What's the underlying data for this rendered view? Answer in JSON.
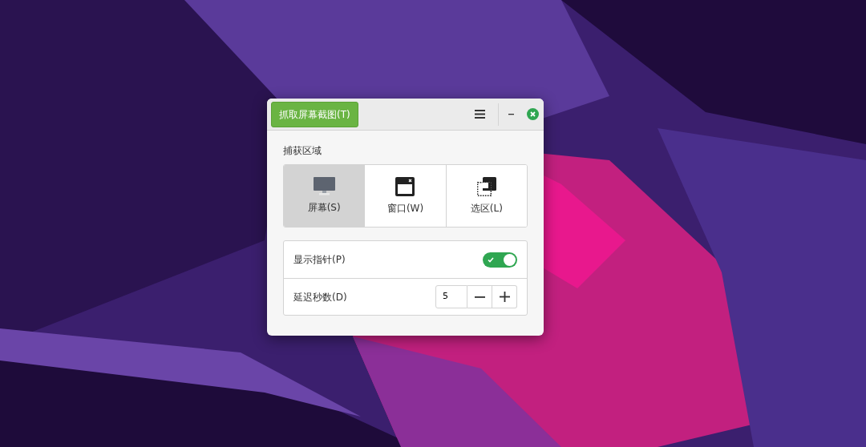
{
  "window": {
    "capture_button": "抓取屏幕截图(T)"
  },
  "area": {
    "label": "捕获区域",
    "modes": [
      {
        "kind": "screen",
        "label": "屏幕(S)",
        "selected": true
      },
      {
        "kind": "window",
        "label": "窗口(W)",
        "selected": false
      },
      {
        "kind": "selection",
        "label": "选区(L)",
        "selected": false
      }
    ]
  },
  "options": {
    "pointer": {
      "label": "显示指针(P)",
      "on": true
    },
    "delay": {
      "label": "延迟秒数(D)",
      "value": "5"
    }
  }
}
